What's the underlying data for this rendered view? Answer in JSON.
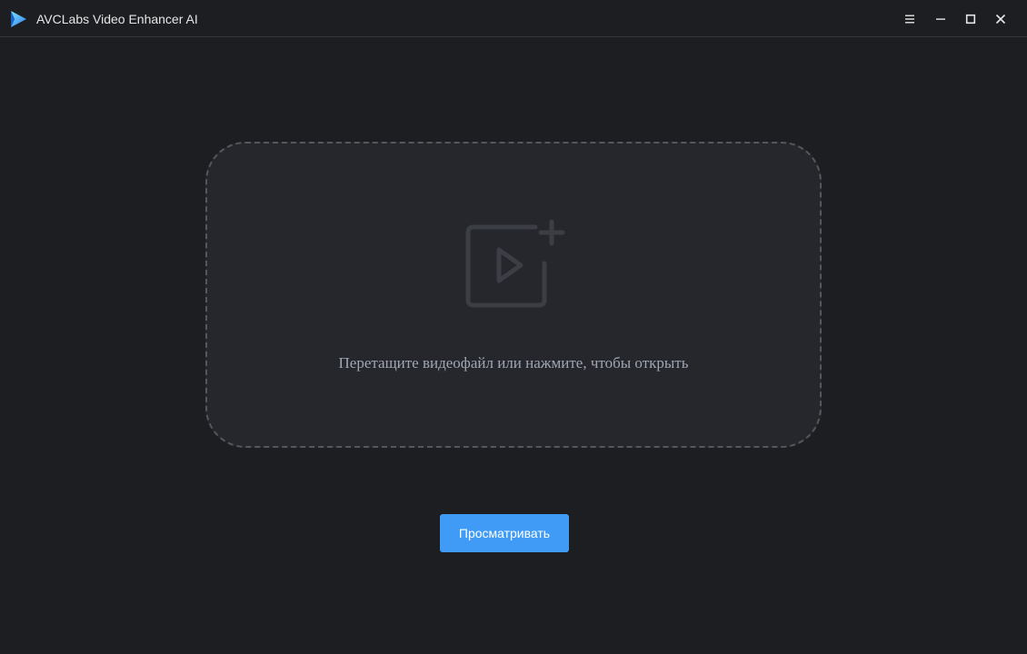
{
  "titlebar": {
    "app_title": "AVCLabs Video Enhancer AI",
    "logo_icon": "play-triangle-logo",
    "controls": [
      {
        "name": "menu-icon",
        "glyph": "≡"
      },
      {
        "name": "minimize-icon",
        "glyph": "—"
      },
      {
        "name": "maximize-icon",
        "glyph": "□"
      },
      {
        "name": "close-icon",
        "glyph": "✕"
      }
    ]
  },
  "dropzone": {
    "icon": "video-add-icon",
    "prompt": "Перетащите видеофайл или нажмите, чтобы открыть"
  },
  "browse_button": {
    "label": "Просматривать"
  },
  "colors": {
    "background": "#1d1e22",
    "dropzone_bg": "#26272c",
    "accent": "#3f9bf5",
    "text_muted": "#9fa6b4"
  }
}
